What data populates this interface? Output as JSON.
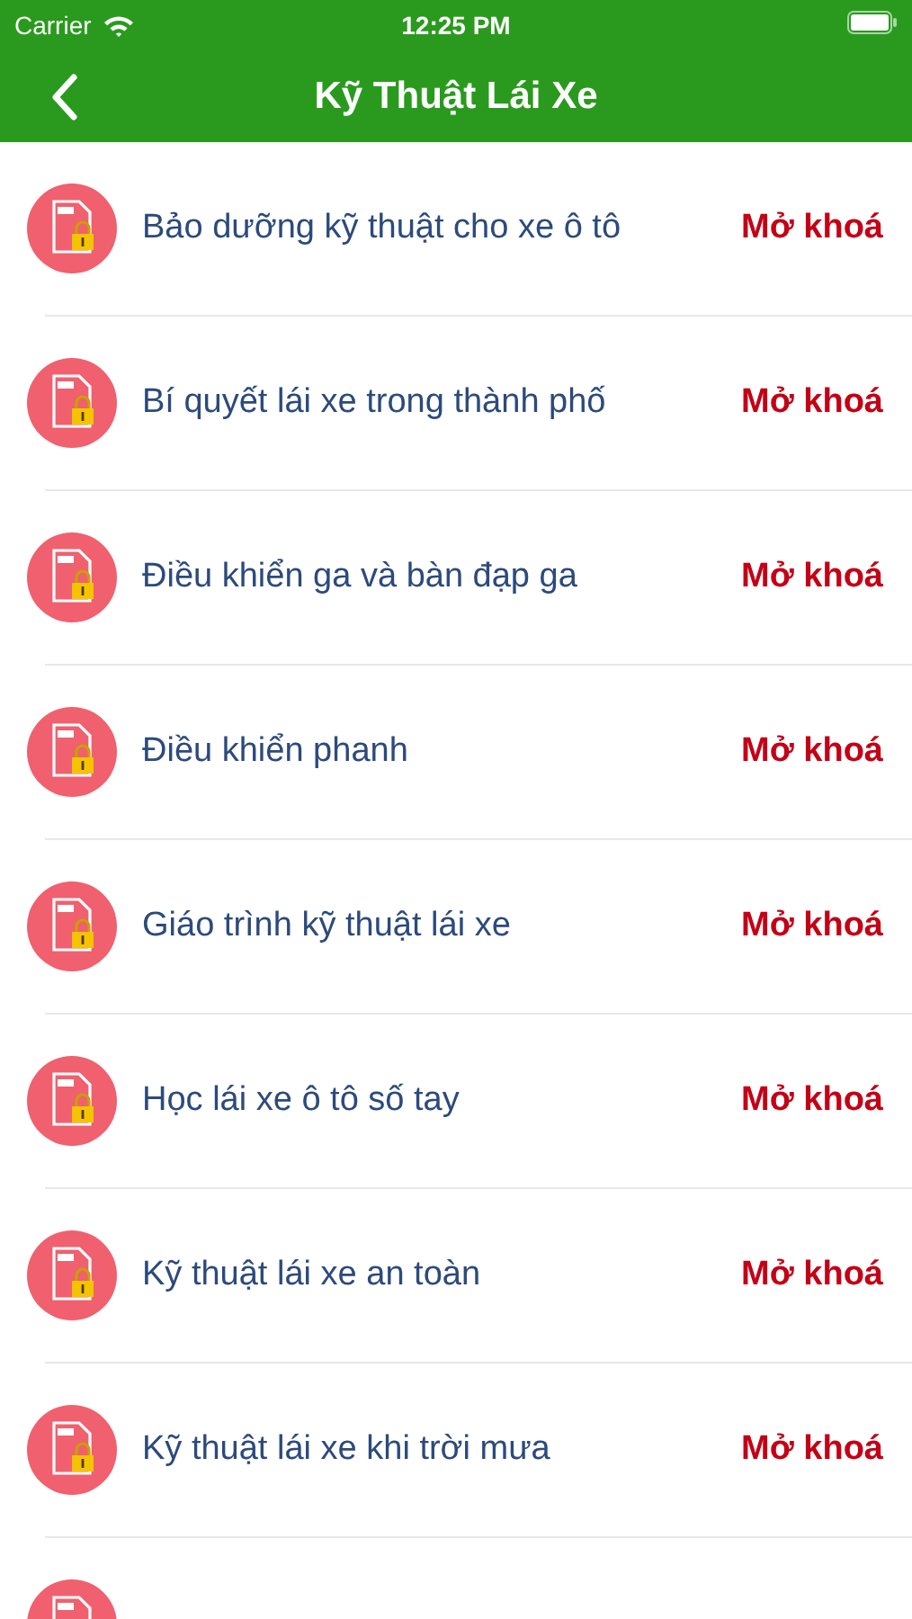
{
  "status_bar": {
    "carrier": "Carrier",
    "time": "12:25 PM"
  },
  "nav": {
    "title": "Kỹ Thuật Lái Xe"
  },
  "items": [
    {
      "title": "Bảo dưỡng kỹ thuật cho xe ô tô",
      "action": "Mở khoá"
    },
    {
      "title": "Bí quyết lái xe trong thành phố",
      "action": "Mở khoá"
    },
    {
      "title": "Điều khiển ga và bàn đạp ga",
      "action": "Mở khoá"
    },
    {
      "title": "Điều khiển phanh",
      "action": "Mở khoá"
    },
    {
      "title": "Giáo trình kỹ thuật lái xe",
      "action": "Mở khoá"
    },
    {
      "title": "Học lái xe ô tô số tay",
      "action": "Mở khoá"
    },
    {
      "title": "Kỹ thuật lái xe an toàn",
      "action": "Mở khoá"
    },
    {
      "title": "Kỹ thuật lái xe khi trời mưa",
      "action": "Mở khoá"
    }
  ]
}
